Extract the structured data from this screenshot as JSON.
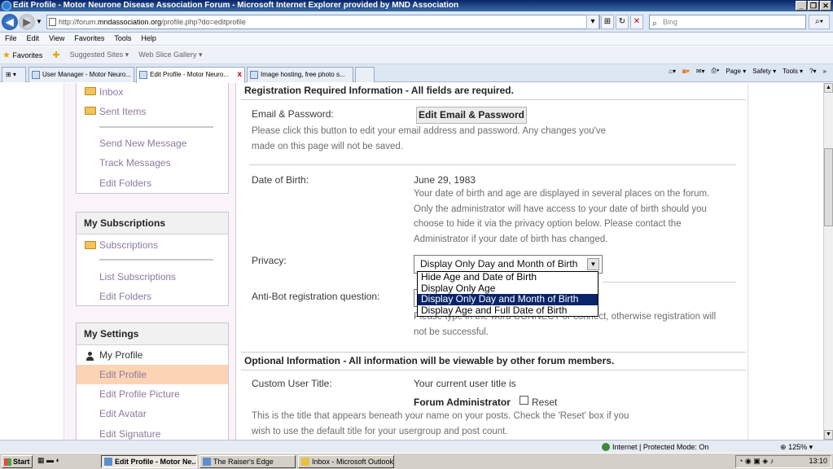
{
  "window": {
    "title": "Edit Profile - Motor Neurone Disease Association Forum - Microsoft Internet Explorer provided by MND Association"
  },
  "address_bar": {
    "url_prefix": "http://forum.",
    "url_domain": "mndassociation.org",
    "url_suffix": "/profile.php?do=editprofile",
    "search_placeholder": "Bing"
  },
  "menu": [
    "File",
    "Edit",
    "View",
    "Favorites",
    "Tools",
    "Help"
  ],
  "favorites_bar": {
    "favorites_label": "Favorites",
    "suggested_sites": "Suggested Sites ▾",
    "web_slice_gallery": "Web Slice Gallery ▾"
  },
  "tabs": [
    {
      "label": "User Manager - Motor Neuro..."
    },
    {
      "label": "Edit Profile - Motor Neuro..."
    },
    {
      "label": "Image hosting, free photo s..."
    }
  ],
  "command_bar": {
    "page": "Page ▾",
    "safety": "Safety ▾",
    "tools": "Tools ▾"
  },
  "sidebar": {
    "inbox": "Inbox",
    "sent_items": "Sent Items",
    "send_new_message": "Send New Message",
    "track_messages": "Track Messages",
    "edit_folders_1": "Edit Folders",
    "my_subscriptions_head": "My Subscriptions",
    "subscriptions": "Subscriptions",
    "list_subscriptions": "List Subscriptions",
    "edit_folders_2": "Edit Folders",
    "my_settings_head": "My Settings",
    "my_profile": "My Profile",
    "edit_profile": "Edit Profile",
    "edit_profile_picture": "Edit Profile Picture",
    "edit_avatar": "Edit Avatar",
    "edit_signature": "Edit Signature"
  },
  "main": {
    "registration_head": "Registration Required Information - All fields are required.",
    "email_label": "Email & Password:",
    "email_button": "Edit Email & Password",
    "email_desc_1": "Please click this button to edit your email address and password. Any changes you've",
    "email_desc_2": "made on this page will not be saved.",
    "dob_label": "Date of Birth:",
    "dob_value": "June 29, 1983",
    "dob_desc_1": "Your date of birth and age are displayed in several places on the forum.",
    "dob_desc_2": "Only the administrator will have access to your date of birth should you",
    "dob_desc_3": "choose to hide it via the privacy option below. Please contact the",
    "dob_desc_4": "Administrator if your date of birth has changed.",
    "privacy_label": "Privacy:",
    "privacy_selected": "Display Only Day and Month of Birth",
    "privacy_options": [
      "Hide Age and Date of Birth",
      "Display Only Age",
      "Display Only Day and Month of Birth",
      "Display Age and Full Date of Birth"
    ],
    "antibot_label": "Anti-Bot registration question:",
    "antibot_desc_1": "Please type in the word CONNECT or connect, otherwise registration will",
    "antibot_desc_2": "not be successful.",
    "optional_head": "Optional Information - All information will be viewable by other forum members.",
    "custom_title_label": "Custom User Title:",
    "custom_title_current": "Your current user title is",
    "custom_title_value": "Forum Administrator",
    "reset_label": "Reset",
    "custom_title_desc_1": "This is the title that appears beneath your name on your posts. Check the 'Reset' box if you",
    "custom_title_desc_2": "wish to use the default title for your usergroup and post count."
  },
  "status_bar": {
    "zone": "Internet | Protected Mode: On",
    "zoom": "125%"
  },
  "taskbar": {
    "start": "Start",
    "tasks": [
      {
        "label": "Edit Profile - Motor Ne..."
      },
      {
        "label": "The Raiser's Edge"
      },
      {
        "label": "Inbox - Microsoft Outlook"
      }
    ],
    "clock": "13:10"
  }
}
